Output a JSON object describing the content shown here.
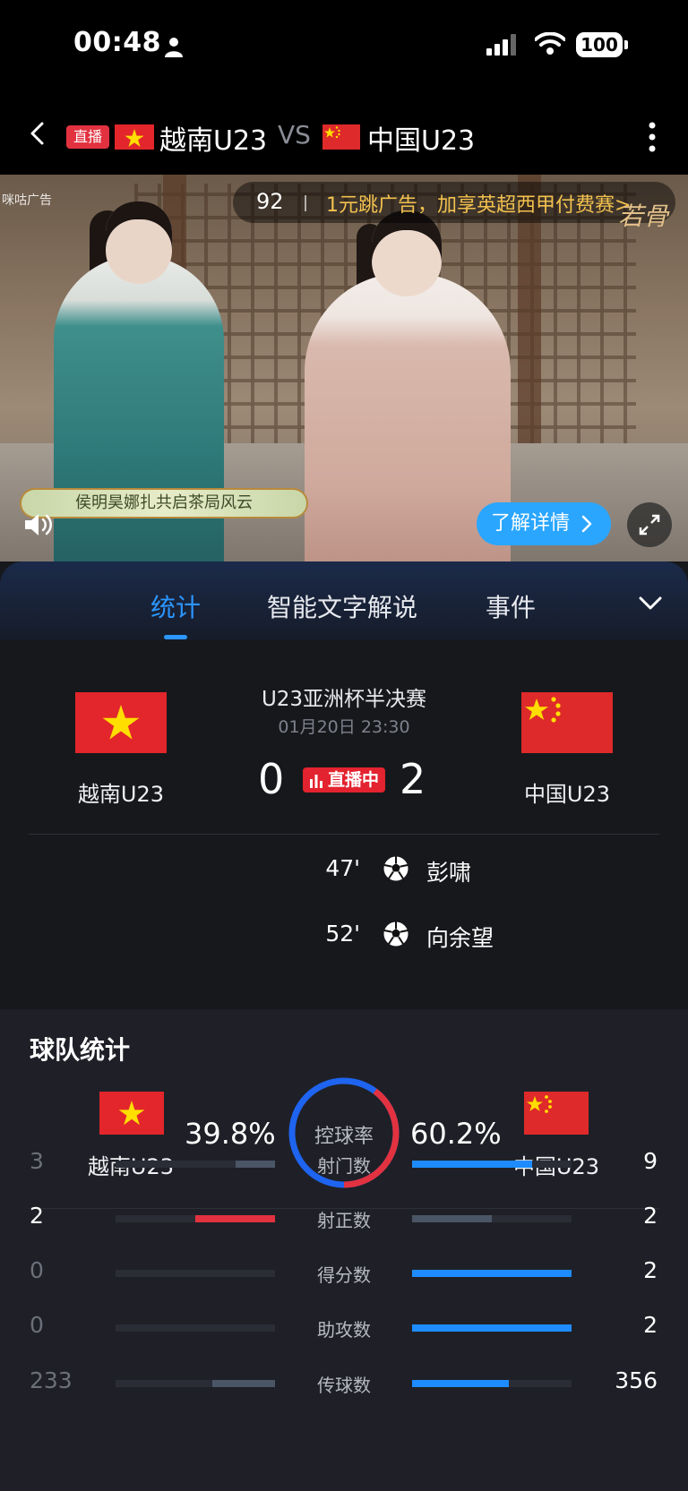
{
  "status_bar": {
    "time": "00:48",
    "battery": "100"
  },
  "header": {
    "live_badge": "直播",
    "team_a": "越南U23",
    "vs": "VS",
    "team_b": "中国U23"
  },
  "video": {
    "ad_label": "咪咕广告",
    "ad_countdown": "92",
    "ad_offer": "1元跳广告，加享英超西甲付费赛>",
    "drama_logo": "若骨",
    "promo_banner": "侯明昊娜扎共启茶局风云",
    "learn_more": "了解详情"
  },
  "tabs": [
    {
      "label": "统计",
      "active": true
    },
    {
      "label": "智能文字解说",
      "active": false
    },
    {
      "label": "事件",
      "active": false
    }
  ],
  "match": {
    "competition": "U23亚洲杯半决赛",
    "kickoff": "01月20日 23:30",
    "team_a": {
      "name": "越南U23",
      "score": "0"
    },
    "team_b": {
      "name": "中国U23",
      "score": "2"
    },
    "status": "直播中",
    "goals": [
      {
        "minute": "47'",
        "player": "彭啸"
      },
      {
        "minute": "52'",
        "player": "向余望"
      }
    ]
  },
  "team_stats": {
    "title": "球队统计",
    "possession_label": "控球率",
    "team_a": {
      "name": "越南U23",
      "possession": "39.8%"
    },
    "team_b": {
      "name": "中国U23",
      "possession": "60.2%"
    },
    "possession_fraction_a": 0.398,
    "rows": [
      {
        "label": "射门数",
        "a": "3",
        "b": "9",
        "a_num": 3,
        "b_num": 9,
        "winner": "b"
      },
      {
        "label": "射正数",
        "a": "2",
        "b": "2",
        "a_num": 2,
        "b_num": 2,
        "winner": "tie"
      },
      {
        "label": "得分数",
        "a": "0",
        "b": "2",
        "a_num": 0,
        "b_num": 2,
        "winner": "b"
      },
      {
        "label": "助攻数",
        "a": "0",
        "b": "2",
        "a_num": 0,
        "b_num": 2,
        "winner": "b"
      },
      {
        "label": "传球数",
        "a": "233",
        "b": "356",
        "a_num": 233,
        "b_num": 356,
        "winner": "b"
      }
    ]
  },
  "colors": {
    "accent_blue": "#2b96ff",
    "team_a_red": "#e23240",
    "live_red": "#e3232f",
    "neutral_bar": "#4a5566"
  }
}
